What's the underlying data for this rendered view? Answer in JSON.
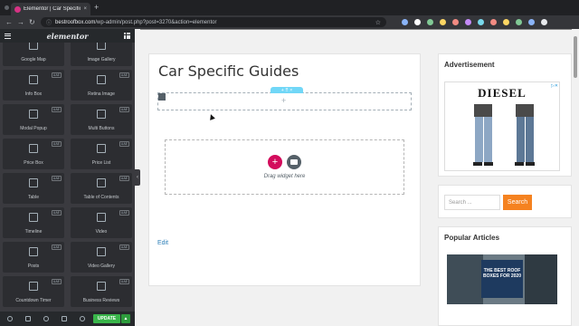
{
  "browser": {
    "tab_title": "Elementor | Car Specific Guides",
    "new_tab": "+",
    "tab_close": "×",
    "url_host": "bestroofbox.com",
    "url_path": "/wp-admin/post.php?post=3270&action=elementor",
    "back": "←",
    "forward": "→",
    "reload": "↻",
    "star": "☆",
    "lock": "ⓘ",
    "extension_colors": [
      "#8ab4f8",
      "#ffffff",
      "#81c995",
      "#fdd663",
      "#f28b82",
      "#c58af9",
      "#78d9ec",
      "#f28b82",
      "#fdd663",
      "#81c995",
      "#8ab4f8",
      "#e8eaed"
    ]
  },
  "editor": {
    "logo": "elementor",
    "widgets": [
      {
        "label": "Google Map",
        "pro": false
      },
      {
        "label": "Image Gallery",
        "pro": false
      },
      {
        "label": "Info Box",
        "pro": true
      },
      {
        "label": "Retina Image",
        "pro": true
      },
      {
        "label": "Modal Popup",
        "pro": true
      },
      {
        "label": "Multi Buttons",
        "pro": true
      },
      {
        "label": "Price Box",
        "pro": true
      },
      {
        "label": "Price List",
        "pro": true
      },
      {
        "label": "Table",
        "pro": true
      },
      {
        "label": "Table of Contents",
        "pro": true
      },
      {
        "label": "Timeline",
        "pro": true
      },
      {
        "label": "Video",
        "pro": true
      },
      {
        "label": "Posts",
        "pro": true
      },
      {
        "label": "Video Gallery",
        "pro": true
      },
      {
        "label": "Countdown Timer",
        "pro": true
      },
      {
        "label": "Business Reviews",
        "pro": true
      }
    ],
    "pro_badge": "UAE",
    "update_label": "UPDATE",
    "update_arrow": "▲",
    "collapse": "‹"
  },
  "page": {
    "title": "Car Specific Guides",
    "section_handle": "+ ⠿ ×",
    "section_plus": "+",
    "add_icon": "+",
    "drop_text": "Drag widget here",
    "edit_link": "Edit"
  },
  "sidebar": {
    "ad_title": "Advertisement",
    "ad_brand": "DIESEL",
    "ad_corner": "▷✕",
    "search_placeholder": "Search ...",
    "search_button": "Search",
    "popular_title": "Popular Articles",
    "popular_image_text": "THE BEST ROOF BOXES FOR 2020"
  }
}
